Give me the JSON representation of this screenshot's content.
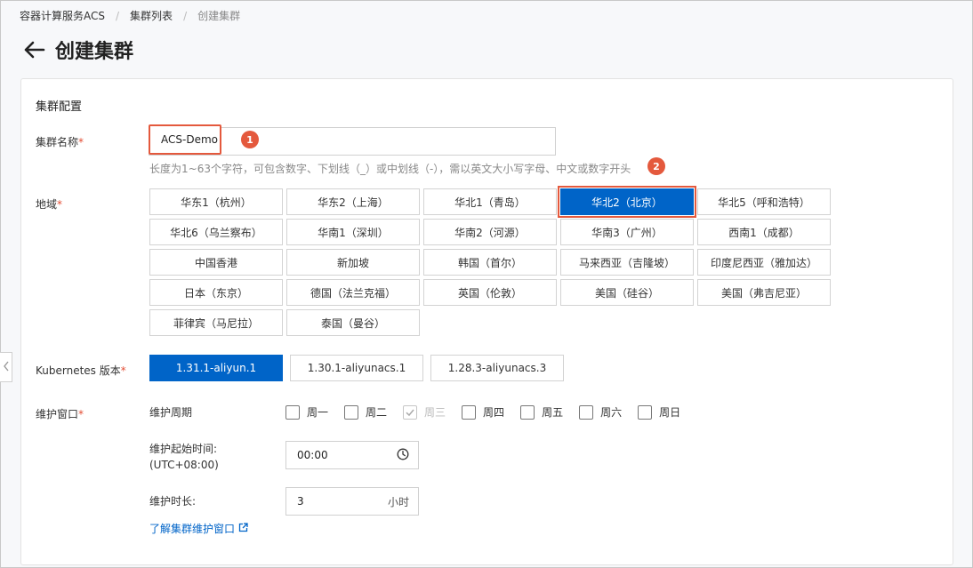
{
  "breadcrumb": [
    "容器计算服务ACS",
    "集群列表",
    "创建集群"
  ],
  "page_title": "创建集群",
  "section_title": "集群配置",
  "cluster_name": {
    "label": "集群名称",
    "value": "ACS-Demo",
    "hint": "长度为1~63个字符，可包含数字、下划线（_）或中划线（-），需以英文大小写字母、中文或数字开头",
    "badge": "1"
  },
  "region": {
    "label": "地域",
    "badge": "2",
    "selected": "华北2（北京）",
    "options": [
      "华东1（杭州）",
      "华东2（上海）",
      "华北1（青岛）",
      "华北2（北京）",
      "华北5（呼和浩特）",
      "华北6（乌兰察布）",
      "华南1（深圳）",
      "华南2（河源）",
      "华南3（广州）",
      "西南1（成都）",
      "中国香港",
      "新加坡",
      "韩国（首尔）",
      "马来西亚（吉隆坡）",
      "印度尼西亚（雅加达）",
      "日本（东京）",
      "德国（法兰克福）",
      "英国（伦敦）",
      "美国（硅谷）",
      "美国（弗吉尼亚）",
      "菲律宾（马尼拉）",
      "泰国（曼谷）"
    ]
  },
  "kubernetes": {
    "label": "Kubernetes 版本",
    "selected": "1.31.1-aliyun.1",
    "options": [
      "1.31.1-aliyun.1",
      "1.30.1-aliyunacs.1",
      "1.28.3-aliyunacs.3"
    ]
  },
  "maintenance": {
    "label": "维护窗口",
    "period_label": "维护周期",
    "days": [
      {
        "name": "周一",
        "checked": false,
        "disabled": false
      },
      {
        "name": "周二",
        "checked": false,
        "disabled": false
      },
      {
        "name": "周三",
        "checked": true,
        "disabled": true
      },
      {
        "name": "周四",
        "checked": false,
        "disabled": false
      },
      {
        "name": "周五",
        "checked": false,
        "disabled": false
      },
      {
        "name": "周六",
        "checked": false,
        "disabled": false
      },
      {
        "name": "周日",
        "checked": false,
        "disabled": false
      }
    ],
    "start_label": "维护起始时间:",
    "start_tz": "(UTC+08:00)",
    "start_value": "00:00",
    "duration_label": "维护时长:",
    "duration_value": "3",
    "duration_unit": "小时",
    "learn_link": "了解集群维护窗口"
  },
  "colors": {
    "primary": "#0064c8",
    "highlight": "#e4593d",
    "required": "#e34d34"
  }
}
